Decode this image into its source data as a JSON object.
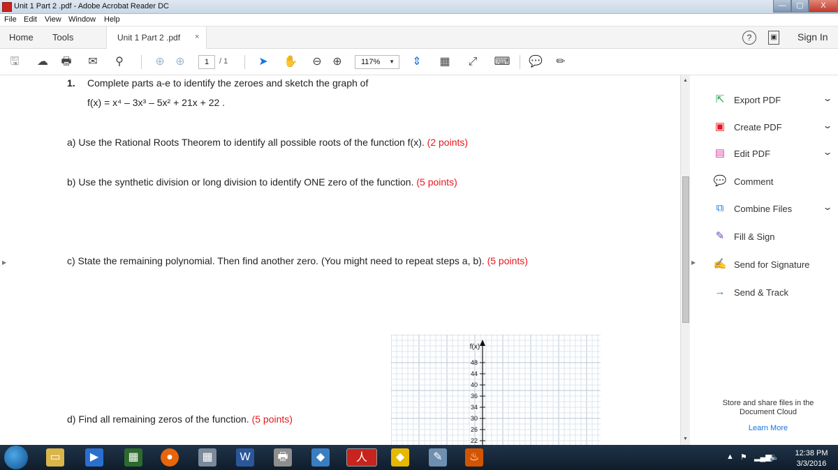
{
  "window": {
    "title": "Unit 1 Part 2 .pdf - Adobe Acrobat Reader DC",
    "minimize": "—",
    "maximize": "▢",
    "close": "X"
  },
  "menu": [
    "File",
    "Edit",
    "View",
    "Window",
    "Help"
  ],
  "tabs": {
    "home": "Home",
    "tools": "Tools",
    "document": "Unit 1 Part 2 .pdf",
    "close": "×",
    "sign_in": "Sign In",
    "help": "?"
  },
  "toolbar": {
    "page_current": "1",
    "page_total": "/ 1",
    "zoom": "117%"
  },
  "document": {
    "q1_number": "1.",
    "q1_text": "Complete parts a-e to identify the zeroes and sketch the graph of",
    "function": "f(x) = x⁴ – 3x³ – 5x² + 21x + 22 .",
    "part_a": "a) Use the Rational Roots Theorem to identify all possible roots of the function f(x).",
    "part_a_points": "(2 points)",
    "part_b": "b) Use the synthetic division or long division to identify ONE zero of the function.",
    "part_b_points": "(5 points)",
    "part_c": "c) State the remaining polynomial. Then find another zero.  (You might need to repeat steps a, b).",
    "part_c_points": "(5 points)",
    "part_d": "d) Find all remaining zeros of the function.",
    "part_d_points": "(5 points)",
    "graph": {
      "axis_label": "f(x)",
      "y_ticks": [
        "48",
        "44",
        "40",
        "36",
        "34",
        "30",
        "26",
        "22"
      ]
    }
  },
  "right_pane": {
    "items": [
      {
        "label": "Export PDF",
        "icon": "export-pdf-icon",
        "color": "#1ea34a",
        "glyph": "⇱",
        "chevron": true
      },
      {
        "label": "Create PDF",
        "icon": "create-pdf-icon",
        "color": "#e8171c",
        "glyph": "▣",
        "chevron": true
      },
      {
        "label": "Edit PDF",
        "icon": "edit-pdf-icon",
        "color": "#d84ba6",
        "glyph": "▤",
        "chevron": true
      },
      {
        "label": "Comment",
        "icon": "comment-icon",
        "color": "#f4b400",
        "glyph": "💬",
        "chevron": false
      },
      {
        "label": "Combine Files",
        "icon": "combine-files-icon",
        "color": "#1e7fd8",
        "glyph": "⧉",
        "chevron": true
      },
      {
        "label": "Fill & Sign",
        "icon": "fill-sign-icon",
        "color": "#6b3fc9",
        "glyph": "✎",
        "chevron": false
      },
      {
        "label": "Send for Signature",
        "icon": "send-signature-icon",
        "color": "#6b3fc9",
        "glyph": "✍",
        "chevron": false
      },
      {
        "label": "Send & Track",
        "icon": "send-track-icon",
        "color": "#1e7fd8",
        "glyph": "→",
        "chevron": false
      }
    ],
    "store_text": "Store and share files in the Document Cloud",
    "learn_more": "Learn More"
  },
  "taskbar": {
    "time": "12:38 PM",
    "date": "3/3/2016"
  }
}
